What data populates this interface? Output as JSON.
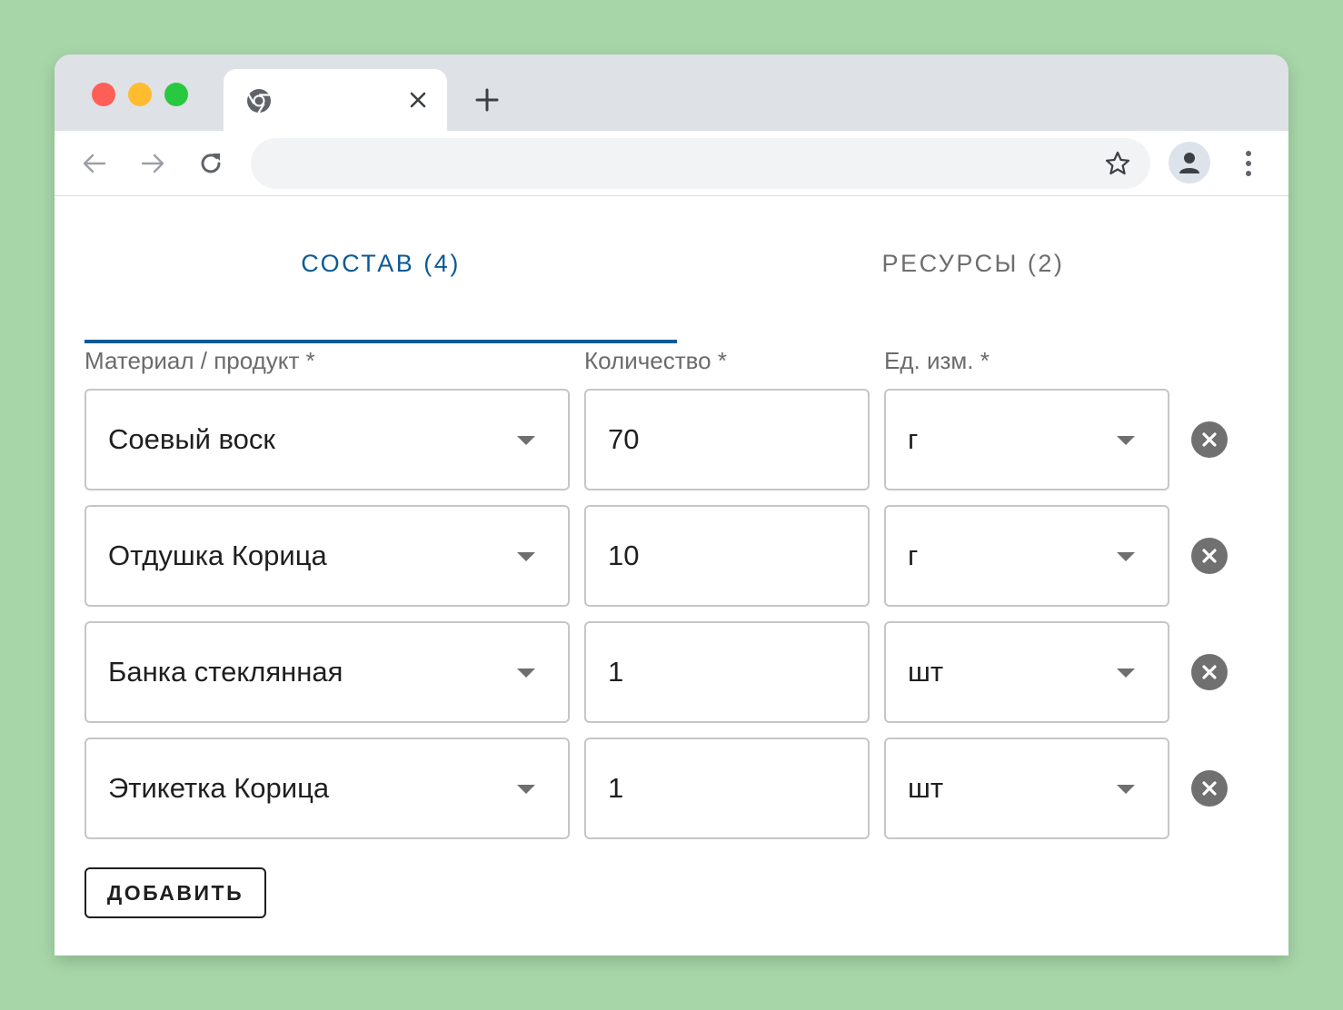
{
  "browser": {
    "tab_title": "",
    "address": ""
  },
  "tabs": [
    {
      "label": "СОСТАВ (4)",
      "active": true
    },
    {
      "label": "РЕСУРСЫ (2)",
      "active": false
    }
  ],
  "columns": {
    "material": "Материал / продукт *",
    "quantity": "Количество *",
    "unit": "Ед. изм. *"
  },
  "rows": [
    {
      "material": "Соевый воск",
      "quantity": "70",
      "unit": "г"
    },
    {
      "material": "Отдушка Корица",
      "quantity": "10",
      "unit": "г"
    },
    {
      "material": "Банка стеклянная",
      "quantity": "1",
      "unit": "шт"
    },
    {
      "material": "Этикетка Корица",
      "quantity": "1",
      "unit": "шт"
    }
  ],
  "actions": {
    "add_label": "ДОБАВИТЬ"
  },
  "colors": {
    "background": "#a7d7a9",
    "accent": "#0d5a93",
    "remove_icon": "#707070"
  },
  "icons": {
    "tab_favicon": "chrome-icon",
    "tab_close": "close-icon",
    "new_tab": "plus-icon",
    "back": "arrow-left-icon",
    "forward": "arrow-right-icon",
    "reload": "reload-icon",
    "bookmark": "star-icon",
    "profile": "person-icon",
    "menu": "kebab-menu-icon",
    "dropdown": "caret-down-icon",
    "remove": "remove-circle-icon"
  }
}
